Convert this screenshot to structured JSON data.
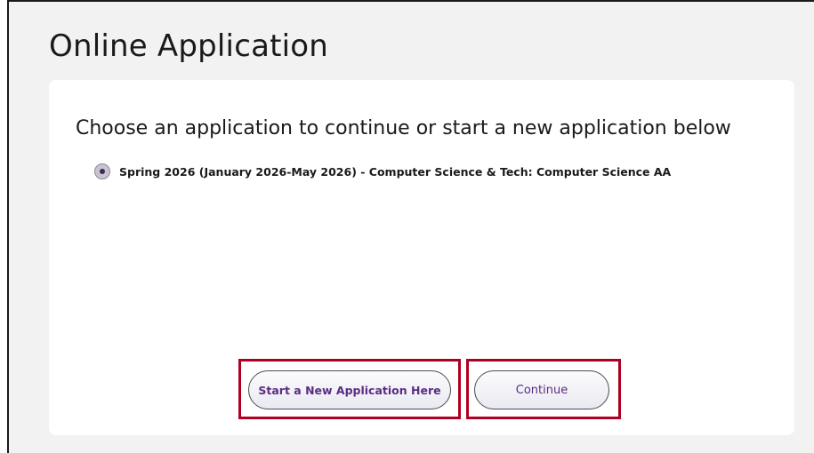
{
  "page": {
    "title": "Online Application"
  },
  "card": {
    "heading": "Choose an application to continue or start a new application below",
    "applications": [
      {
        "label": "Spring 2026 (January 2026-May 2026) - Computer Science & Tech: Computer Science AA",
        "selected": true
      }
    ]
  },
  "actions": {
    "start_new_label": "Start a New Application Here",
    "continue_label": "Continue"
  },
  "colors": {
    "accent_text": "#5b2c83",
    "highlight_border": "#b00020",
    "page_background": "#f2f2f2",
    "card_background": "#ffffff"
  },
  "icons": {
    "radio": "radio-selected-icon"
  }
}
